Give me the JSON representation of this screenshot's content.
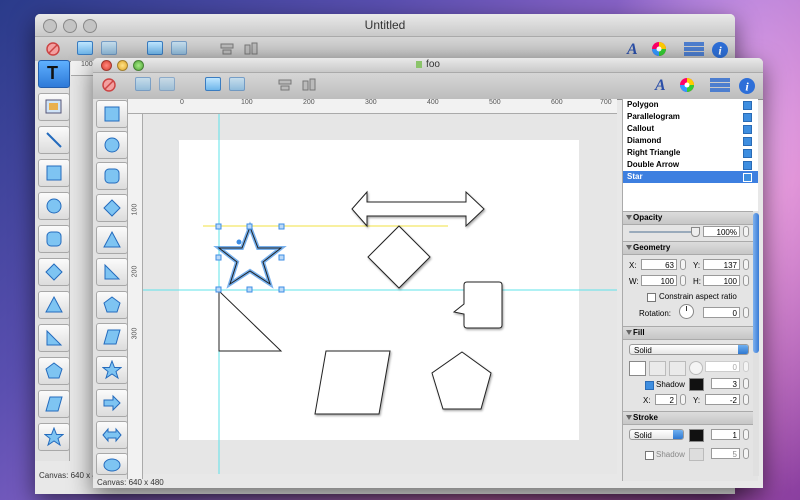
{
  "back_window": {
    "title": "Untitled",
    "status": "Canvas: 640 x 480",
    "ruler_labels": [
      "100"
    ]
  },
  "front_window": {
    "title": "foo",
    "status": "Canvas: 640 x 480",
    "ruler_h_labels": [
      "0",
      "100",
      "200",
      "300",
      "400",
      "500",
      "600",
      "700"
    ],
    "ruler_v_labels": [
      "100",
      "200",
      "300"
    ]
  },
  "tools": {
    "text_tool": "T",
    "items": [
      "text",
      "image",
      "line",
      "rectangle",
      "circle",
      "rounded-rectangle",
      "diamond",
      "triangle",
      "right-triangle",
      "pentagon",
      "parallelogram",
      "star"
    ]
  },
  "shape_palette": [
    "rectangle",
    "circle",
    "rounded-rectangle",
    "diamond",
    "triangle",
    "right-triangle",
    "pentagon",
    "parallelogram",
    "star",
    "arrow",
    "double-arrow",
    "callout"
  ],
  "layers": {
    "items": [
      {
        "label": "Polygon",
        "checked": true
      },
      {
        "label": "Parallelogram",
        "checked": true
      },
      {
        "label": "Callout",
        "checked": true
      },
      {
        "label": "Diamond",
        "checked": true
      },
      {
        "label": "Right Triangle",
        "checked": true
      },
      {
        "label": "Double Arrow",
        "checked": true
      },
      {
        "label": "Star",
        "checked": true,
        "selected": true
      }
    ]
  },
  "inspector": {
    "opacity": {
      "title": "Opacity",
      "value": "100%",
      "level": 1.0
    },
    "geometry": {
      "title": "Geometry",
      "x_label": "X:",
      "x": "63",
      "y_label": "Y:",
      "y": "137",
      "w_label": "W:",
      "w": "100",
      "h_label": "H:",
      "h": "100",
      "constrain_label": "Constrain aspect ratio",
      "rotation_label": "Rotation:",
      "rotation": "0"
    },
    "fill": {
      "title": "Fill",
      "type": "Solid",
      "angle": "0",
      "shadow_label": "Shadow",
      "shadow_checked": true,
      "shadow_size": "3",
      "x_label": "X:",
      "x": "2",
      "y_label": "Y:",
      "y": "-2"
    },
    "stroke": {
      "title": "Stroke",
      "type": "Solid",
      "width": "1",
      "shadow_label": "Shadow",
      "shadow_size": "5"
    }
  },
  "colors": {
    "selection": "#3d8ee6",
    "guide_cyan": "#5fe3ea",
    "guide_yellow": "#f0e040",
    "selected_row": "#3d7fe0"
  }
}
